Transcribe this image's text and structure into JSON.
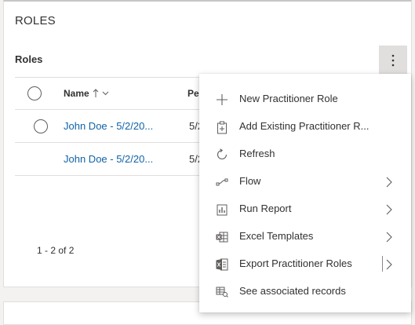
{
  "section": {
    "title": "ROLES"
  },
  "subgrid": {
    "title": "Roles",
    "columns": {
      "name": "Name",
      "second": "Per"
    },
    "rows": [
      {
        "name": "John Doe - 5/2/20...",
        "second": "5/2"
      },
      {
        "name": "John Doe - 5/2/20...",
        "second": "5/2"
      }
    ],
    "paging": "1 - 2 of 2"
  },
  "menu": {
    "items": [
      {
        "label": "New Practitioner Role",
        "icon": "add-icon"
      },
      {
        "label": "Add Existing Practitioner R...",
        "icon": "clipboard-add-icon"
      },
      {
        "label": "Refresh",
        "icon": "refresh-icon"
      },
      {
        "label": "Flow",
        "icon": "flow-icon",
        "submenu": true
      },
      {
        "label": "Run Report",
        "icon": "report-icon",
        "submenu": true
      },
      {
        "label": "Excel Templates",
        "icon": "excel-templates-icon",
        "submenu": true
      },
      {
        "label": "Export Practitioner Roles",
        "icon": "excel-export-icon",
        "submenu": true,
        "split": true
      },
      {
        "label": "See associated records",
        "icon": "associated-records-icon"
      }
    ]
  },
  "colors": {
    "link": "#1062a8",
    "text": "#323130",
    "border": "#e1dfdd",
    "active_button": "#e1dfdd"
  }
}
